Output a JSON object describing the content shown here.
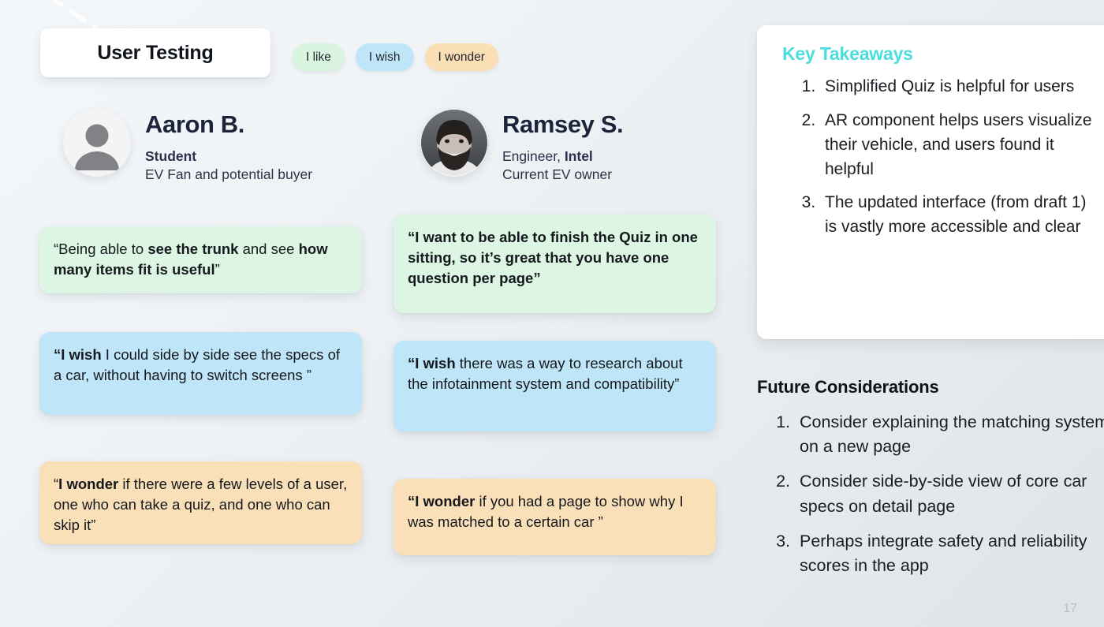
{
  "header": {
    "title": "User Testing",
    "tags": [
      {
        "label": "I like",
        "color": "#d9f5e0"
      },
      {
        "label": "I wish",
        "color": "#bfe6f8"
      },
      {
        "label": "I wonder",
        "color": "#fadfb5"
      }
    ]
  },
  "personas": [
    {
      "name": "Aaron B.",
      "role_bold": "Student",
      "role_rest": "",
      "subtitle": "EV Fan and potential buyer",
      "avatar_icon": "person-placeholder-icon"
    },
    {
      "name": "Ramsey S.",
      "role_bold": "Intel",
      "role_prefix": "Engineer, ",
      "subtitle": "Current EV owner",
      "avatar_icon": "user-photo-avatar"
    }
  ],
  "quotes": {
    "aaron": [
      {
        "type": "like",
        "color": "#ddf6e4",
        "text_html": "“Being able to <b>see the trunk</b> and see <b>how many items fit is useful</b>”"
      },
      {
        "type": "wish",
        "color": "#bfe6f8",
        "text_html": "<b>“I wish</b> I could side by side see the specs of a car, without having to switch screens ”"
      },
      {
        "type": "wonder",
        "color": "#fae0b9",
        "text_html": "“<b>I wonder</b> if there were a few levels of a user, one who can take a quiz, and one who can skip it”"
      }
    ],
    "ramsey": [
      {
        "type": "like",
        "color": "#ddf6e4",
        "bold_all": true,
        "text_html": "“I want to be able to finish the Quiz in one sitting, so it’s great that you have one question per page”"
      },
      {
        "type": "wish",
        "color": "#bfe6f8",
        "text_html": "<b>“I wish</b> there was a way to research about the infotainment system and compatibility”"
      },
      {
        "type": "wonder",
        "color": "#fae0b9",
        "text_html": "<b>“I wonder</b> if you had a page to show why I was matched to a certain car ”"
      }
    ]
  },
  "key_takeaways": {
    "title": "Key Takeaways",
    "title_color": "#49dde0",
    "items": [
      "Simplified Quiz is helpful for users",
      "AR component helps users visualize their vehicle, and users found it helpful",
      "The updated interface (from draft 1) is vastly more accessible and clear"
    ]
  },
  "future_considerations": {
    "title": "Future Considerations",
    "items": [
      "Consider explaining the matching system on a new page",
      "Consider side-by-side view of core car specs on detail page",
      "Perhaps integrate safety and reliability scores in the app"
    ]
  },
  "page_number": "17"
}
